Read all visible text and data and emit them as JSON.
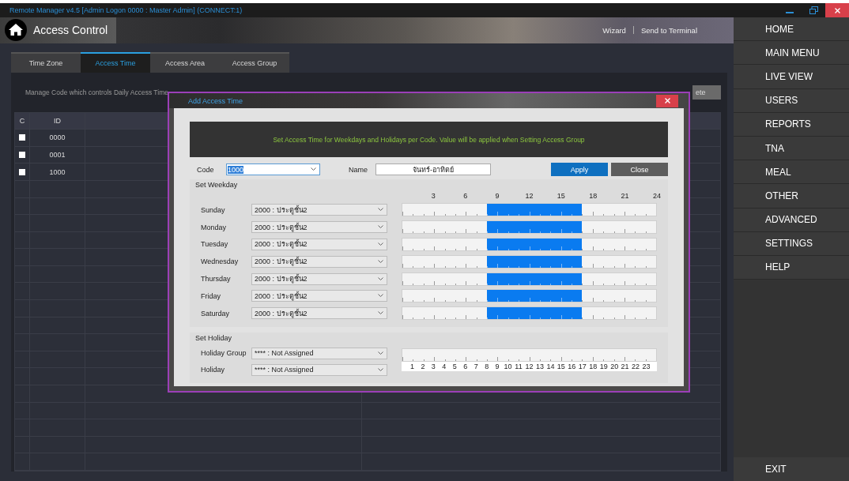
{
  "window": {
    "title": "Remote Manager v4.5 [Admin Logon 0000 : Master Admin] (CONNECT:1)"
  },
  "header": {
    "title": "Access Control",
    "links": [
      "Wizard",
      "Send to Terminal"
    ]
  },
  "tabs": [
    {
      "label": "Time Zone",
      "selected": false
    },
    {
      "label": "Access Time",
      "selected": true
    },
    {
      "label": "Access Area",
      "selected": false
    },
    {
      "label": "Access Group",
      "selected": false
    }
  ],
  "description": "Manage Code which controls Daily Access Time",
  "delete_button": "ete",
  "table": {
    "columns": [
      "C",
      "ID"
    ],
    "rows": [
      {
        "checked": false,
        "id": "0000"
      },
      {
        "checked": false,
        "id": "0001"
      },
      {
        "checked": false,
        "id": "1000"
      }
    ]
  },
  "dialog": {
    "title": "Add Access Time",
    "banner": "Set Access Time for Weekdays and Holidays per Code. Value will be applied when Setting Access Group",
    "code": {
      "label": "Code",
      "value": "1000"
    },
    "name": {
      "label": "Name",
      "value": "จันทร์-อาทิตย์"
    },
    "buttons": [
      "Apply",
      "Close"
    ],
    "weekday_section": "Set Weekday",
    "scale": [
      "3",
      "6",
      "9",
      "12",
      "15",
      "18",
      "21",
      "24"
    ],
    "weekdays": [
      {
        "day": "Sunday",
        "zone": "2000 : ประตูชั้น2",
        "hours": [
          false,
          false,
          false,
          false,
          false,
          false,
          false,
          false,
          true,
          true,
          true,
          true,
          true,
          true,
          true,
          true,
          true,
          false,
          false,
          false,
          false,
          false,
          false,
          false
        ]
      },
      {
        "day": "Monday",
        "zone": "2000 : ประตูชั้น2",
        "hours": [
          false,
          false,
          false,
          false,
          false,
          false,
          false,
          false,
          true,
          true,
          true,
          true,
          true,
          true,
          true,
          true,
          true,
          false,
          false,
          false,
          false,
          false,
          false,
          false
        ]
      },
      {
        "day": "Tuesday",
        "zone": "2000 : ประตูชั้น2",
        "hours": [
          false,
          false,
          false,
          false,
          false,
          false,
          false,
          false,
          true,
          true,
          true,
          true,
          true,
          true,
          true,
          true,
          true,
          false,
          false,
          false,
          false,
          false,
          false,
          false
        ]
      },
      {
        "day": "Wednesday",
        "zone": "2000 : ประตูชั้น2",
        "hours": [
          false,
          false,
          false,
          false,
          false,
          false,
          false,
          false,
          true,
          true,
          true,
          true,
          true,
          true,
          true,
          true,
          true,
          false,
          false,
          false,
          false,
          false,
          false,
          false
        ]
      },
      {
        "day": "Thursday",
        "zone": "2000 : ประตูชั้น2",
        "hours": [
          false,
          false,
          false,
          false,
          false,
          false,
          false,
          false,
          true,
          true,
          true,
          true,
          true,
          true,
          true,
          true,
          true,
          false,
          false,
          false,
          false,
          false,
          false,
          false
        ]
      },
      {
        "day": "Friday",
        "zone": "2000 : ประตูชั้น2",
        "hours": [
          false,
          false,
          false,
          false,
          false,
          false,
          false,
          false,
          true,
          true,
          true,
          true,
          true,
          true,
          true,
          true,
          true,
          false,
          false,
          false,
          false,
          false,
          false,
          false
        ]
      },
      {
        "day": "Saturday",
        "zone": "2000 : ประตูชั้น2",
        "hours": [
          false,
          false,
          false,
          false,
          false,
          false,
          false,
          false,
          true,
          true,
          true,
          true,
          true,
          true,
          true,
          true,
          true,
          false,
          false,
          false,
          false,
          false,
          false,
          false
        ]
      }
    ],
    "holiday_section": "Set Holiday",
    "holiday_fields": [
      {
        "label": "Holiday Group",
        "value": "**** : Not Assigned"
      },
      {
        "label": "Holiday",
        "value": "**** : Not Assigned"
      }
    ],
    "holiday_hours": [
      false,
      false,
      false,
      false,
      false,
      false,
      false,
      false,
      false,
      false,
      false,
      false,
      false,
      false,
      false,
      false,
      false,
      false,
      false,
      false,
      false,
      false,
      false,
      false
    ],
    "holiday_scale": [
      "1",
      "2",
      "3",
      "4",
      "5",
      "6",
      "7",
      "8",
      "9",
      "10",
      "11",
      "12",
      "13",
      "14",
      "15",
      "16",
      "17",
      "18",
      "19",
      "20",
      "21",
      "22",
      "23"
    ]
  },
  "sidebar": {
    "items": [
      "HOME",
      "MAIN MENU",
      "LIVE VIEW",
      "USERS",
      "REPORTS",
      "TNA",
      "MEAL",
      "OTHER",
      "ADVANCED",
      "SETTINGS",
      "HELP"
    ],
    "exit": "EXIT"
  }
}
